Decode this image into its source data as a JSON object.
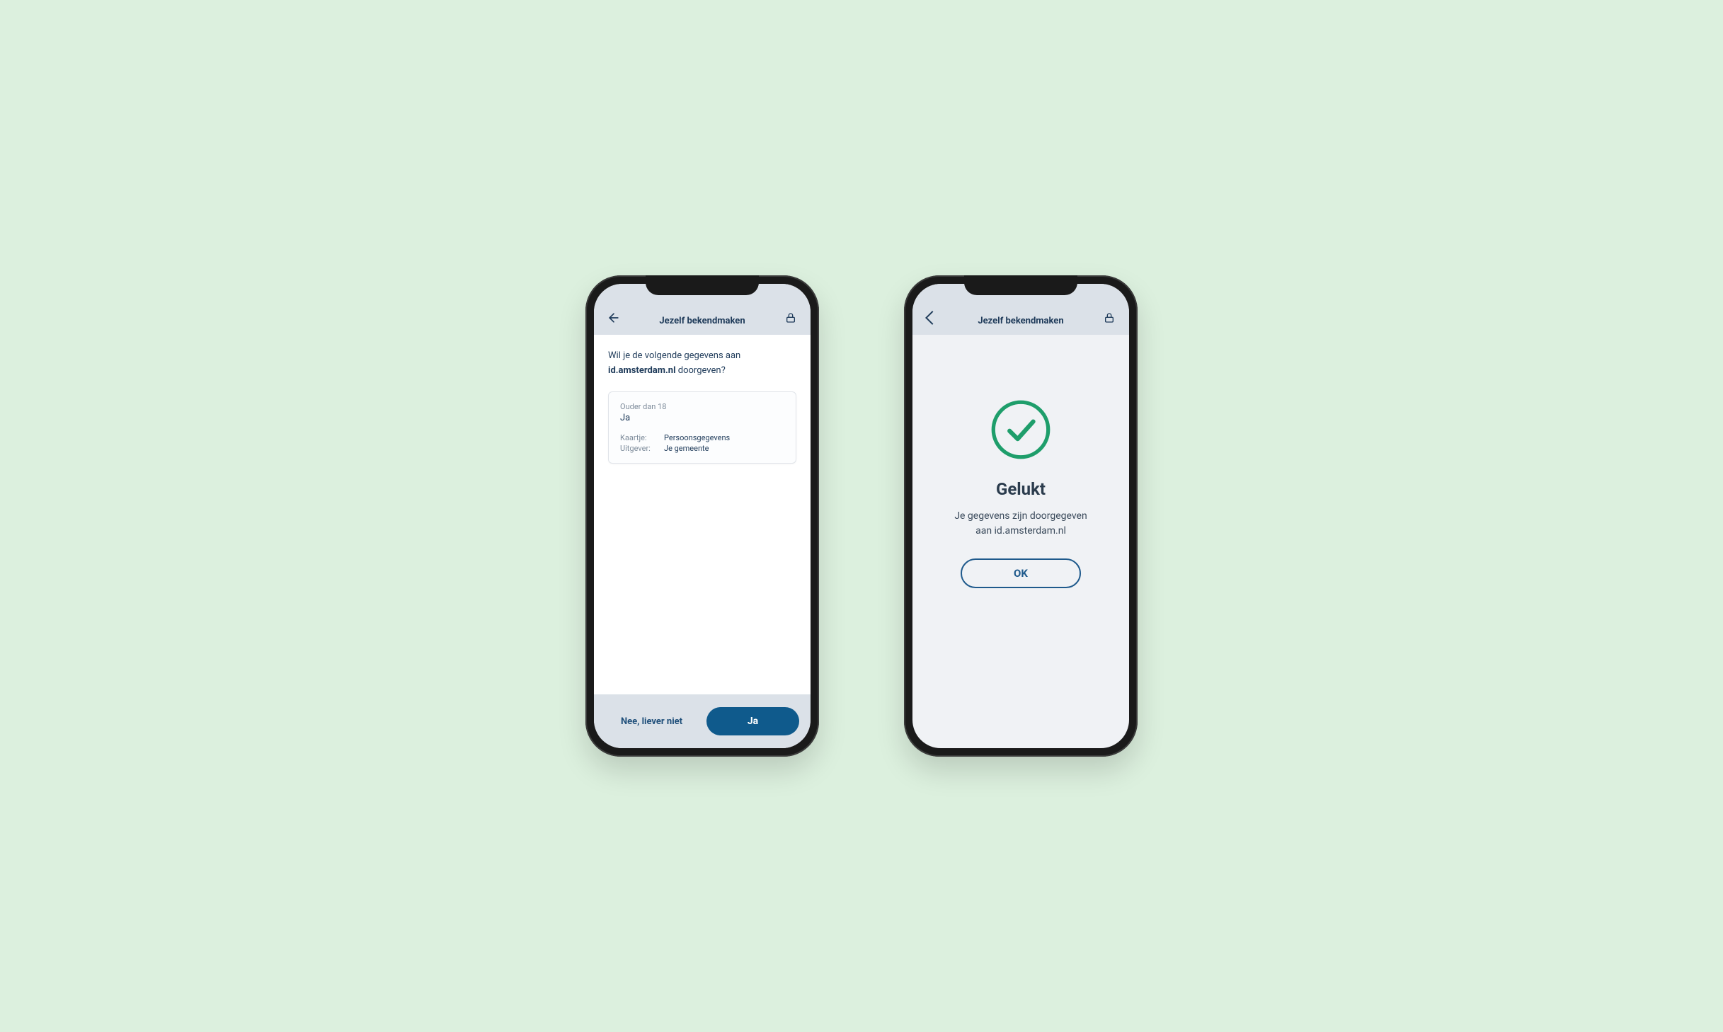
{
  "consent": {
    "header": {
      "title": "Jezelf bekendmaken"
    },
    "prompt_pre": "Wil je de volgende gegevens aan ",
    "prompt_bold": "id.amsterdam.nl",
    "prompt_post": " doorgeven?",
    "card": {
      "label": "Ouder dan 18",
      "value": "Ja",
      "meta": [
        {
          "key": "Kaartje:",
          "val": "Persoonsgegevens"
        },
        {
          "key": "Uitgever:",
          "val": "Je gemeente"
        }
      ]
    },
    "footer": {
      "decline": "Nee, liever niet",
      "accept": "Ja"
    }
  },
  "success": {
    "header": {
      "title": "Jezelf bekendmaken"
    },
    "title": "Gelukt",
    "text_line1": "Je gegevens zijn doorgegeven",
    "text_line2": "aan id.amsterdam.nl",
    "ok": "OK"
  },
  "colors": {
    "bg": "#dcf0de",
    "primary": "#0f5a8c",
    "green": "#1e9e6b",
    "header_bg": "#dbe1e8",
    "text_dark": "#1f3b5a"
  }
}
